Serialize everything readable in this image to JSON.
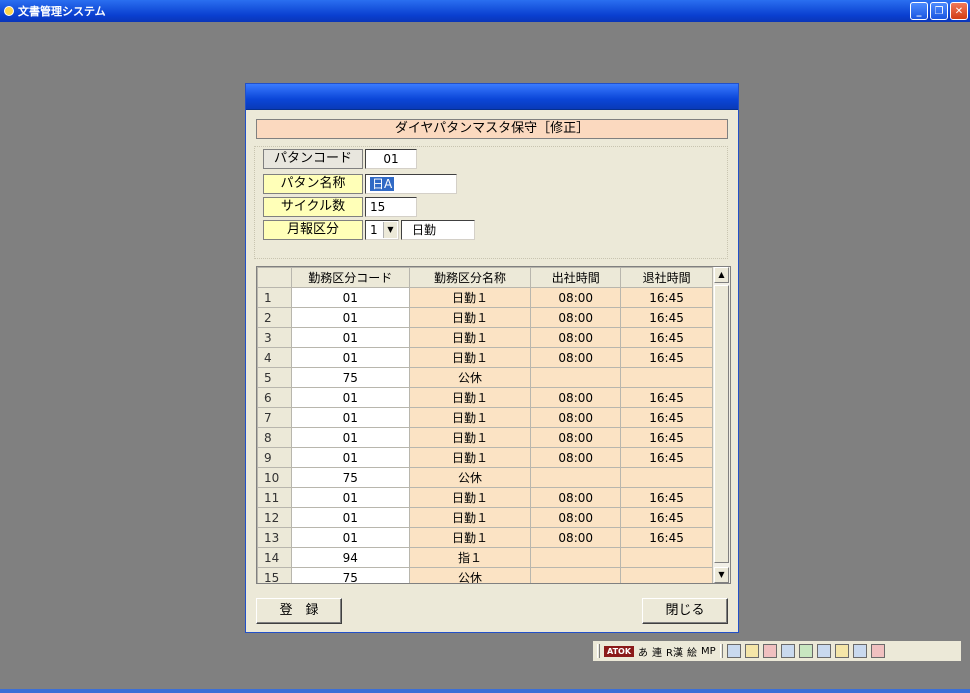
{
  "app": {
    "title": "文書管理システム",
    "window_buttons": [
      "_",
      "❐",
      "✕"
    ]
  },
  "dialog": {
    "screen_title": "ダイヤパタンマスタ保守［修正］",
    "fields": {
      "pattern_code_label": "パタンコード",
      "pattern_code_value": "01",
      "pattern_name_label": "パタン名称",
      "pattern_name_value": "日A",
      "cycle_count_label": "サイクル数",
      "cycle_count_value": "15",
      "monthly_type_label": "月報区分",
      "monthly_type_value": "1",
      "monthly_type_name": "日勤"
    },
    "grid": {
      "columns": [
        "勤務区分コード",
        "勤務区分名称",
        "出社時間",
        "退社時間"
      ],
      "rows": [
        {
          "no": "1",
          "code": "01",
          "name": "日勤１",
          "in": "08:00",
          "out": "16:45"
        },
        {
          "no": "2",
          "code": "01",
          "name": "日勤１",
          "in": "08:00",
          "out": "16:45"
        },
        {
          "no": "3",
          "code": "01",
          "name": "日勤１",
          "in": "08:00",
          "out": "16:45"
        },
        {
          "no": "4",
          "code": "01",
          "name": "日勤１",
          "in": "08:00",
          "out": "16:45"
        },
        {
          "no": "5",
          "code": "75",
          "name": "公休",
          "in": "",
          "out": ""
        },
        {
          "no": "6",
          "code": "01",
          "name": "日勤１",
          "in": "08:00",
          "out": "16:45"
        },
        {
          "no": "7",
          "code": "01",
          "name": "日勤１",
          "in": "08:00",
          "out": "16:45"
        },
        {
          "no": "8",
          "code": "01",
          "name": "日勤１",
          "in": "08:00",
          "out": "16:45"
        },
        {
          "no": "9",
          "code": "01",
          "name": "日勤１",
          "in": "08:00",
          "out": "16:45"
        },
        {
          "no": "10",
          "code": "75",
          "name": "公休",
          "in": "",
          "out": ""
        },
        {
          "no": "11",
          "code": "01",
          "name": "日勤１",
          "in": "08:00",
          "out": "16:45"
        },
        {
          "no": "12",
          "code": "01",
          "name": "日勤１",
          "in": "08:00",
          "out": "16:45"
        },
        {
          "no": "13",
          "code": "01",
          "name": "日勤１",
          "in": "08:00",
          "out": "16:45"
        },
        {
          "no": "14",
          "code": "94",
          "name": "指１",
          "in": "",
          "out": ""
        },
        {
          "no": "15",
          "code": "75",
          "name": "公休",
          "in": "",
          "out": ""
        }
      ]
    },
    "buttons": {
      "register": "登　録",
      "close": "閉じる"
    }
  },
  "langbar": {
    "atok": "ATOK",
    "items": [
      "あ",
      "連",
      "R漢",
      "絵",
      "MP"
    ]
  },
  "colors": {
    "label_yellow": "#ffffb8",
    "title_peach": "#fbd9bf",
    "grid_peach": "#fbe3c4",
    "selection_blue": "#316ac5"
  }
}
